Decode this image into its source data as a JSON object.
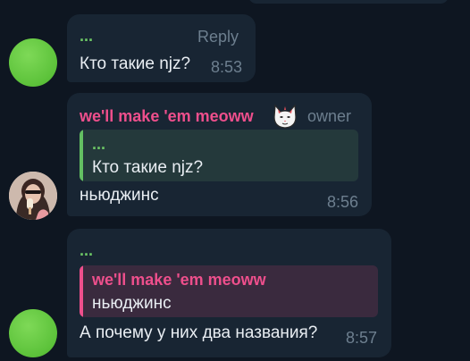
{
  "colors": {
    "background": "#0e1621",
    "bubble": "#182533",
    "green_name": "#6cc665",
    "pink_name": "#ee4f8c",
    "meta_gray": "#6d7f8f"
  },
  "messages": [
    {
      "sender": "...",
      "reply_label": "Reply",
      "text": "Кто такие njz?",
      "time": "8:53",
      "avatar": "green-circle"
    },
    {
      "sender": "we'll make 'em meoww",
      "sender_icon": "cat-mask-icon",
      "role": "owner",
      "quote": {
        "title": "...",
        "text": "Кто такие njz?"
      },
      "text": "ньюджинс",
      "time": "8:56",
      "avatar": "photo"
    },
    {
      "sender": "...",
      "quote": {
        "title": "we'll make 'em meoww",
        "text": "ньюджинс"
      },
      "text": "А почему у них два названия?",
      "time": "8:57",
      "avatar": "green-circle"
    }
  ]
}
